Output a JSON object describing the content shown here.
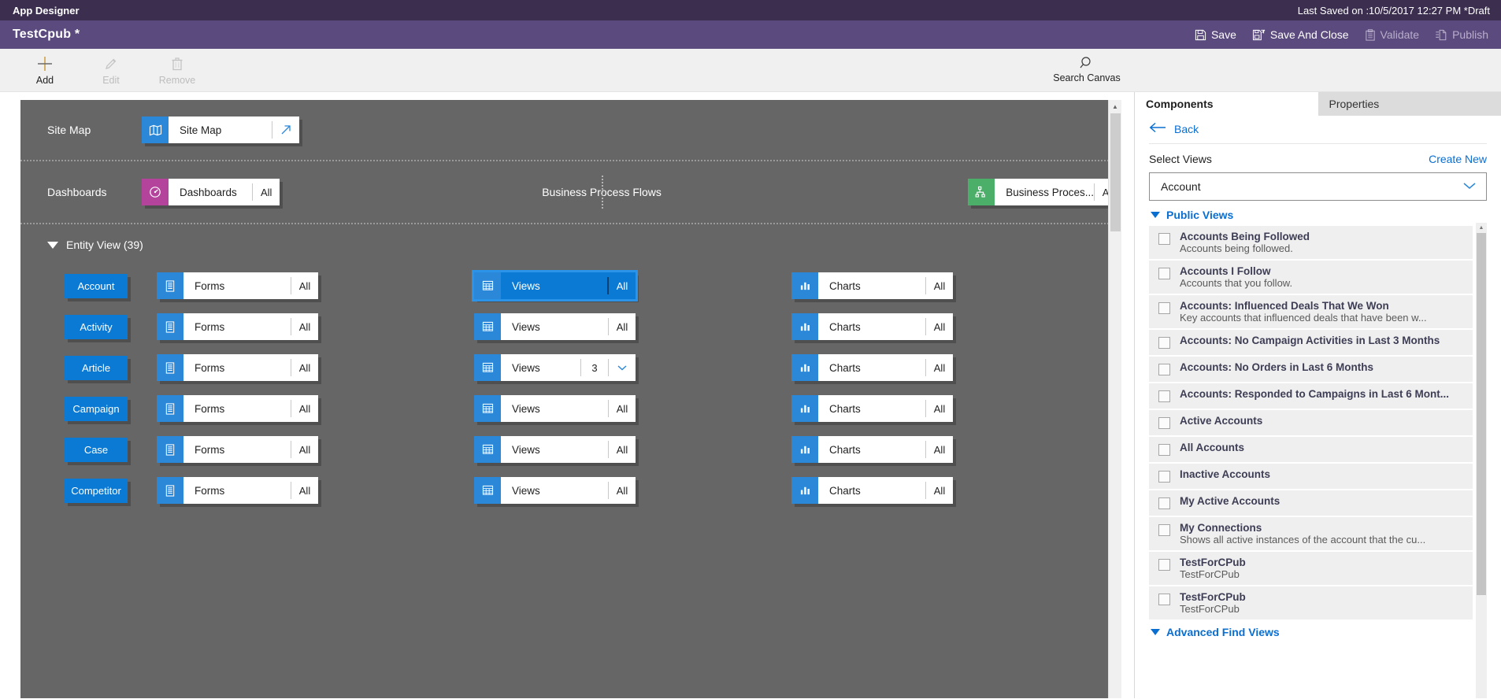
{
  "titlebar": {
    "title": "App Designer",
    "last_saved": "Last Saved on :10/5/2017 12:27 PM *Draft"
  },
  "commandbar": {
    "app_name": "TestCpub *",
    "actions": [
      {
        "label": "Save",
        "icon": "save-icon",
        "enabled": true
      },
      {
        "label": "Save And Close",
        "icon": "save-and-close-icon",
        "enabled": true
      },
      {
        "label": "Validate",
        "icon": "validate-icon",
        "enabled": false
      },
      {
        "label": "Publish",
        "icon": "publish-icon",
        "enabled": false
      }
    ]
  },
  "ribbon": {
    "items": [
      {
        "label": "Add",
        "icon": "plus-icon",
        "enabled": true
      },
      {
        "label": "Edit",
        "icon": "pencil-icon",
        "enabled": false
      },
      {
        "label": "Remove",
        "icon": "trash-icon",
        "enabled": false
      }
    ],
    "search": {
      "label": "Search Canvas",
      "icon": "search-icon"
    }
  },
  "canvas": {
    "sitemap_row": {
      "label": "Site Map",
      "tile": {
        "name": "Site Map",
        "icon": "map-icon",
        "icon_color": "#2b88d8",
        "action_icon": "open-arrow-icon"
      }
    },
    "dashboards_row": {
      "left_label": "Dashboards",
      "left_tile": {
        "name": "Dashboards",
        "qty": "All",
        "icon": "dashboard-icon",
        "icon_color": "#b4439c"
      },
      "right_label": "Business Process Flows",
      "right_tile": {
        "name": "Business Proces...",
        "qty": "All",
        "icon": "process-flow-icon",
        "icon_color": "#4caf69"
      }
    },
    "entity_view": {
      "header": "Entity View (39)",
      "rows": [
        {
          "entity": "Account",
          "forms": {
            "name": "Forms",
            "qty": "All",
            "icon": "form-icon"
          },
          "views": {
            "name": "Views",
            "qty": "All",
            "icon": "grid-icon",
            "selected": true
          },
          "charts": {
            "name": "Charts",
            "qty": "All",
            "icon": "chart-icon"
          }
        },
        {
          "entity": "Activity",
          "forms": {
            "name": "Forms",
            "qty": "All",
            "icon": "form-icon"
          },
          "views": {
            "name": "Views",
            "qty": "All",
            "icon": "grid-icon",
            "selected": false
          },
          "charts": {
            "name": "Charts",
            "qty": "All",
            "icon": "chart-icon"
          }
        },
        {
          "entity": "Article",
          "forms": {
            "name": "Forms",
            "qty": "All",
            "icon": "form-icon"
          },
          "views": {
            "name": "Views",
            "qty": "3",
            "icon": "grid-icon",
            "selected": false,
            "has_chevron": true
          },
          "charts": {
            "name": "Charts",
            "qty": "All",
            "icon": "chart-icon"
          }
        },
        {
          "entity": "Campaign",
          "forms": {
            "name": "Forms",
            "qty": "All",
            "icon": "form-icon"
          },
          "views": {
            "name": "Views",
            "qty": "All",
            "icon": "grid-icon",
            "selected": false
          },
          "charts": {
            "name": "Charts",
            "qty": "All",
            "icon": "chart-icon"
          }
        },
        {
          "entity": "Case",
          "forms": {
            "name": "Forms",
            "qty": "All",
            "icon": "form-icon"
          },
          "views": {
            "name": "Views",
            "qty": "All",
            "icon": "grid-icon",
            "selected": false
          },
          "charts": {
            "name": "Charts",
            "qty": "All",
            "icon": "chart-icon"
          }
        },
        {
          "entity": "Competitor",
          "forms": {
            "name": "Forms",
            "qty": "All",
            "icon": "form-icon"
          },
          "views": {
            "name": "Views",
            "qty": "All",
            "icon": "grid-icon",
            "selected": false
          },
          "charts": {
            "name": "Charts",
            "qty": "All",
            "icon": "chart-icon"
          }
        }
      ]
    }
  },
  "panel": {
    "tabs": [
      {
        "label": "Components",
        "active": true
      },
      {
        "label": "Properties",
        "active": false
      }
    ],
    "back_label": "Back",
    "select_title": "Select Views",
    "create_new": "Create New",
    "entity_combo_value": "Account",
    "groups": [
      {
        "name": "Public Views",
        "expanded": true,
        "items": [
          {
            "name": "Accounts Being Followed",
            "desc": "Accounts being followed.",
            "checked": false
          },
          {
            "name": "Accounts I Follow",
            "desc": "Accounts that you follow.",
            "checked": false
          },
          {
            "name": "Accounts: Influenced Deals That We Won",
            "desc": "Key accounts that influenced deals that have been w...",
            "checked": false
          },
          {
            "name": "Accounts: No Campaign Activities in Last 3 Months",
            "desc": "",
            "checked": false
          },
          {
            "name": "Accounts: No Orders in Last 6 Months",
            "desc": "",
            "checked": false
          },
          {
            "name": "Accounts: Responded to Campaigns in Last 6 Mont...",
            "desc": "",
            "checked": false
          },
          {
            "name": "Active Accounts",
            "desc": "",
            "checked": false
          },
          {
            "name": "All Accounts",
            "desc": "",
            "checked": false
          },
          {
            "name": "Inactive Accounts",
            "desc": "",
            "checked": false
          },
          {
            "name": "My Active Accounts",
            "desc": "",
            "checked": false
          },
          {
            "name": "My Connections",
            "desc": "Shows all active instances of the account that the cu...",
            "checked": false
          },
          {
            "name": "TestForCPub",
            "desc": "TestForCPub",
            "checked": false
          },
          {
            "name": "TestForCPub",
            "desc": "TestForCPub",
            "checked": false
          }
        ]
      },
      {
        "name": "Advanced Find Views",
        "expanded": true,
        "items": []
      }
    ]
  },
  "colors": {
    "titlebar": "#3b2e4f",
    "commandbar": "#5b4a7e",
    "canvas": "#666666",
    "accent_blue": "#0a7ad4",
    "link_blue": "#0a6ed1",
    "magenta": "#b4439c",
    "green": "#4caf69"
  }
}
